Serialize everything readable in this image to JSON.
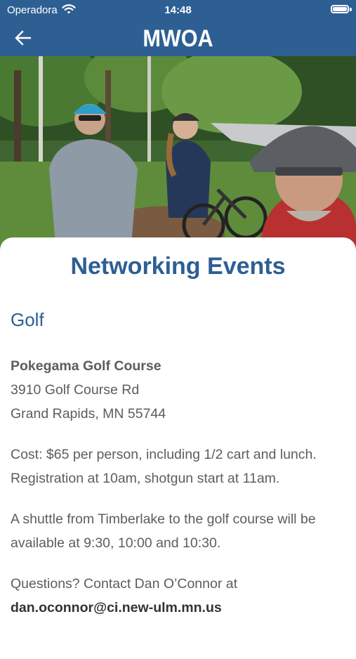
{
  "status_bar": {
    "carrier": "Operadora",
    "time": "14:48"
  },
  "nav": {
    "title": "MWOA",
    "back_icon": "arrow-left-icon"
  },
  "hero": {
    "description_icon": "photo"
  },
  "page": {
    "title": "Networking Events",
    "section": "Golf",
    "venue_name": "Pokegama Golf Course",
    "address_line1": "3910 Golf Course Rd",
    "address_line2": "Grand Rapids, MN 55744",
    "cost_line": "Cost: $65 per person, including 1/2 cart and lunch.",
    "registration_line": "Registration at 10am, shotgun start at 11am.",
    "shuttle_line": "A shuttle from Timberlake to the golf course will be available at 9:30, 10:00 and 10:30.",
    "questions_prefix": "Questions? Contact Dan O’Connor at ",
    "contact_email": "dan.oconnor@ci.new-ulm.mn.us"
  },
  "colors": {
    "brand": "#2d5f93",
    "text": "#5d5d5d"
  }
}
